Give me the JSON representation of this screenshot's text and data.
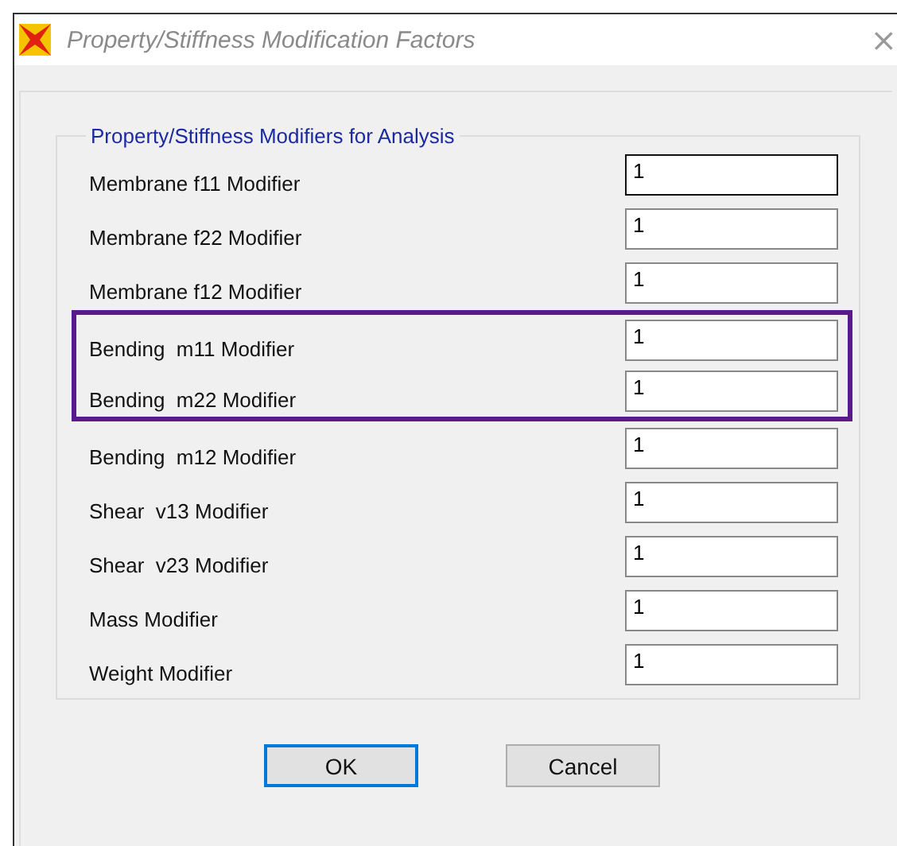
{
  "window": {
    "title": "Property/Stiffness Modification Factors",
    "close": "×"
  },
  "group": {
    "title": "Property/Stiffness Modifiers for Analysis"
  },
  "rows": [
    {
      "label": "Membrane f11 Modifier",
      "value": "1",
      "focused": true,
      "highlighted": false
    },
    {
      "label": "Membrane f22 Modifier",
      "value": "1",
      "focused": false,
      "highlighted": false
    },
    {
      "label": "Membrane f12 Modifier",
      "value": "1",
      "focused": false,
      "highlighted": false
    },
    {
      "label": "Bending  m11 Modifier",
      "value": "1",
      "focused": false,
      "highlighted": true
    },
    {
      "label": "Bending  m22 Modifier",
      "value": "1",
      "focused": false,
      "highlighted": true
    },
    {
      "label": "Bending  m12 Modifier",
      "value": "1",
      "focused": false,
      "highlighted": false
    },
    {
      "label": "Shear  v13 Modifier",
      "value": "1",
      "focused": false,
      "highlighted": false
    },
    {
      "label": "Shear  v23 Modifier",
      "value": "1",
      "focused": false,
      "highlighted": false
    },
    {
      "label": "Mass Modifier",
      "value": "1",
      "focused": false,
      "highlighted": false
    },
    {
      "label": "Weight Modifier",
      "value": "1",
      "focused": false,
      "highlighted": false
    }
  ],
  "buttons": [
    {
      "label": "OK",
      "default": true
    },
    {
      "label": "Cancel",
      "default": false
    }
  ]
}
